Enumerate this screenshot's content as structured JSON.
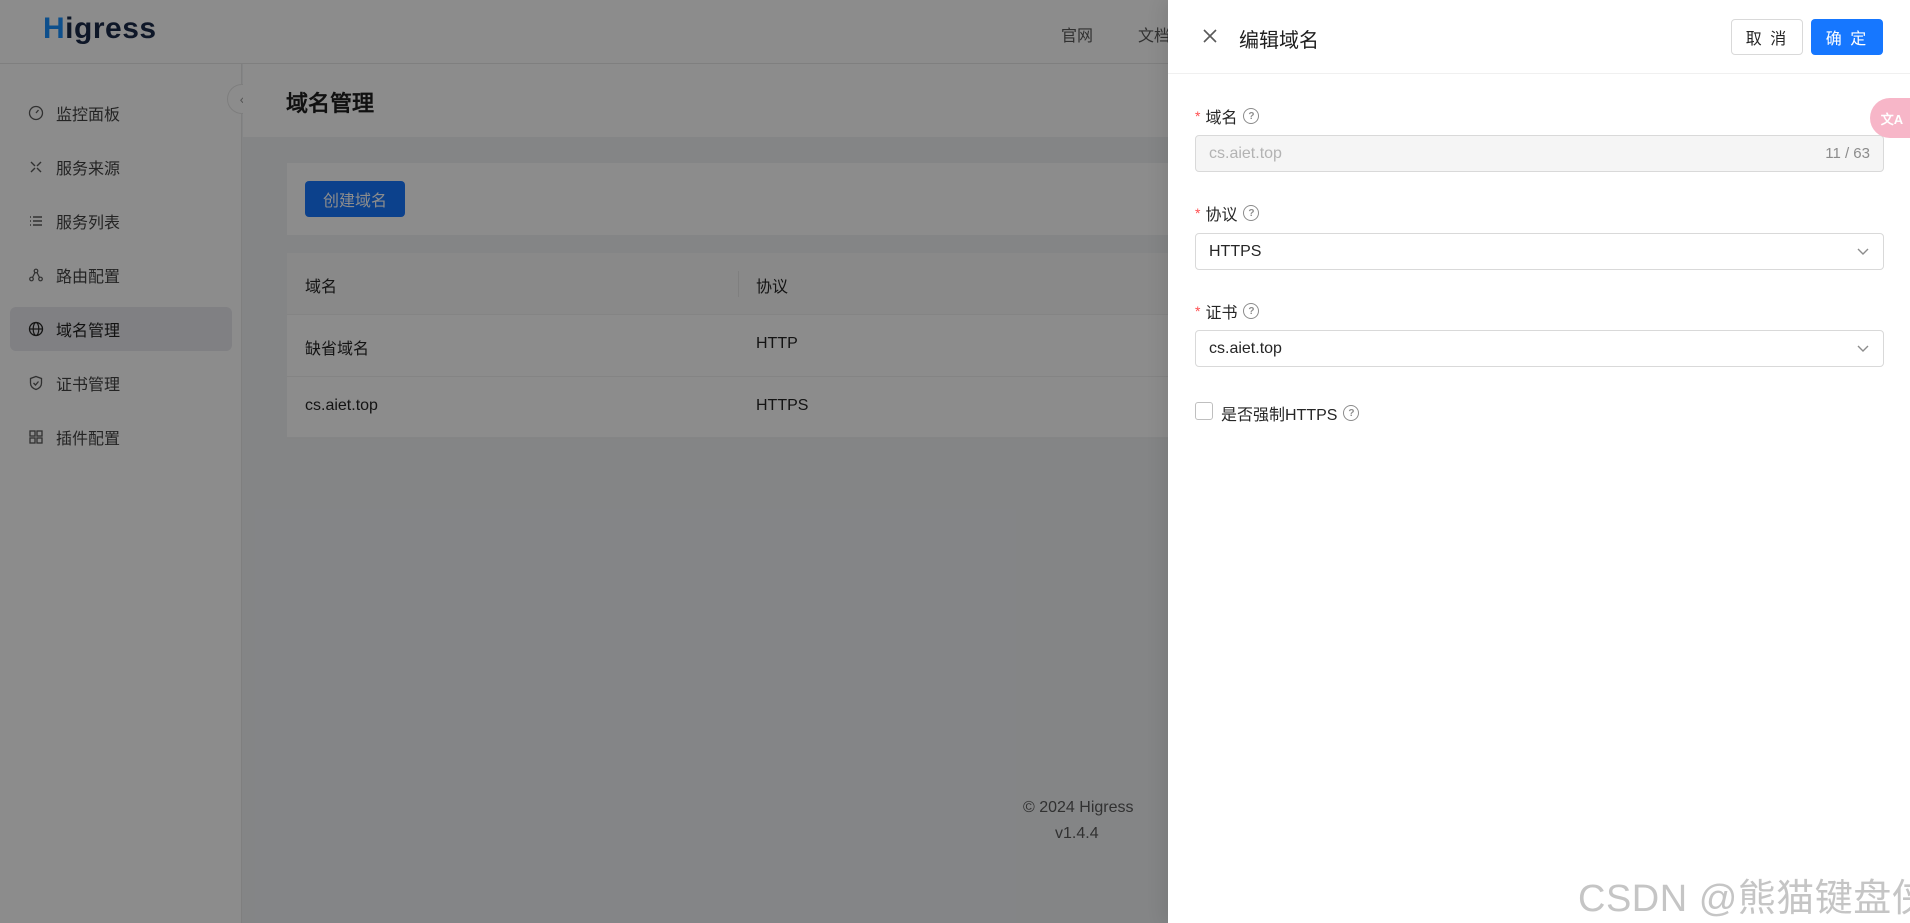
{
  "app": {
    "logo": {
      "first": "H",
      "rest": "igress"
    },
    "topnav": [
      "官网",
      "文档"
    ]
  },
  "sidebar": {
    "items": [
      {
        "label": "监控面板",
        "icon": "dashboard-icon"
      },
      {
        "label": "服务来源",
        "icon": "service-source-icon"
      },
      {
        "label": "服务列表",
        "icon": "list-icon"
      },
      {
        "label": "路由配置",
        "icon": "route-icon"
      },
      {
        "label": "域名管理",
        "icon": "globe-icon",
        "active": true
      },
      {
        "label": "证书管理",
        "icon": "shield-icon"
      },
      {
        "label": "插件配置",
        "icon": "plugin-icon"
      }
    ]
  },
  "page": {
    "title": "域名管理",
    "create_button": "创建域名",
    "table": {
      "columns": [
        "域名",
        "协议"
      ],
      "rows": [
        [
          "缺省域名",
          "HTTP"
        ],
        [
          "cs.aiet.top",
          "HTTPS"
        ]
      ]
    }
  },
  "footer": {
    "copyright": "© 2024 Higress",
    "version": "v1.4.4"
  },
  "drawer": {
    "title": "编辑域名",
    "cancel": "取 消",
    "ok": "确 定",
    "fields": {
      "domain": {
        "label": "域名",
        "value": "cs.aiet.top",
        "count": "11 / 63"
      },
      "protocol": {
        "label": "协议",
        "value": "HTTPS"
      },
      "cert": {
        "label": "证书",
        "value": "cs.aiet.top"
      },
      "force_https": {
        "label": "是否强制HTTPS",
        "checked": false
      }
    }
  },
  "translate_badge": "文A",
  "watermark": "CSDN @熊猫键盘侠",
  "colors": {
    "primary": "#1677ff",
    "required": "#ff4d4f"
  }
}
